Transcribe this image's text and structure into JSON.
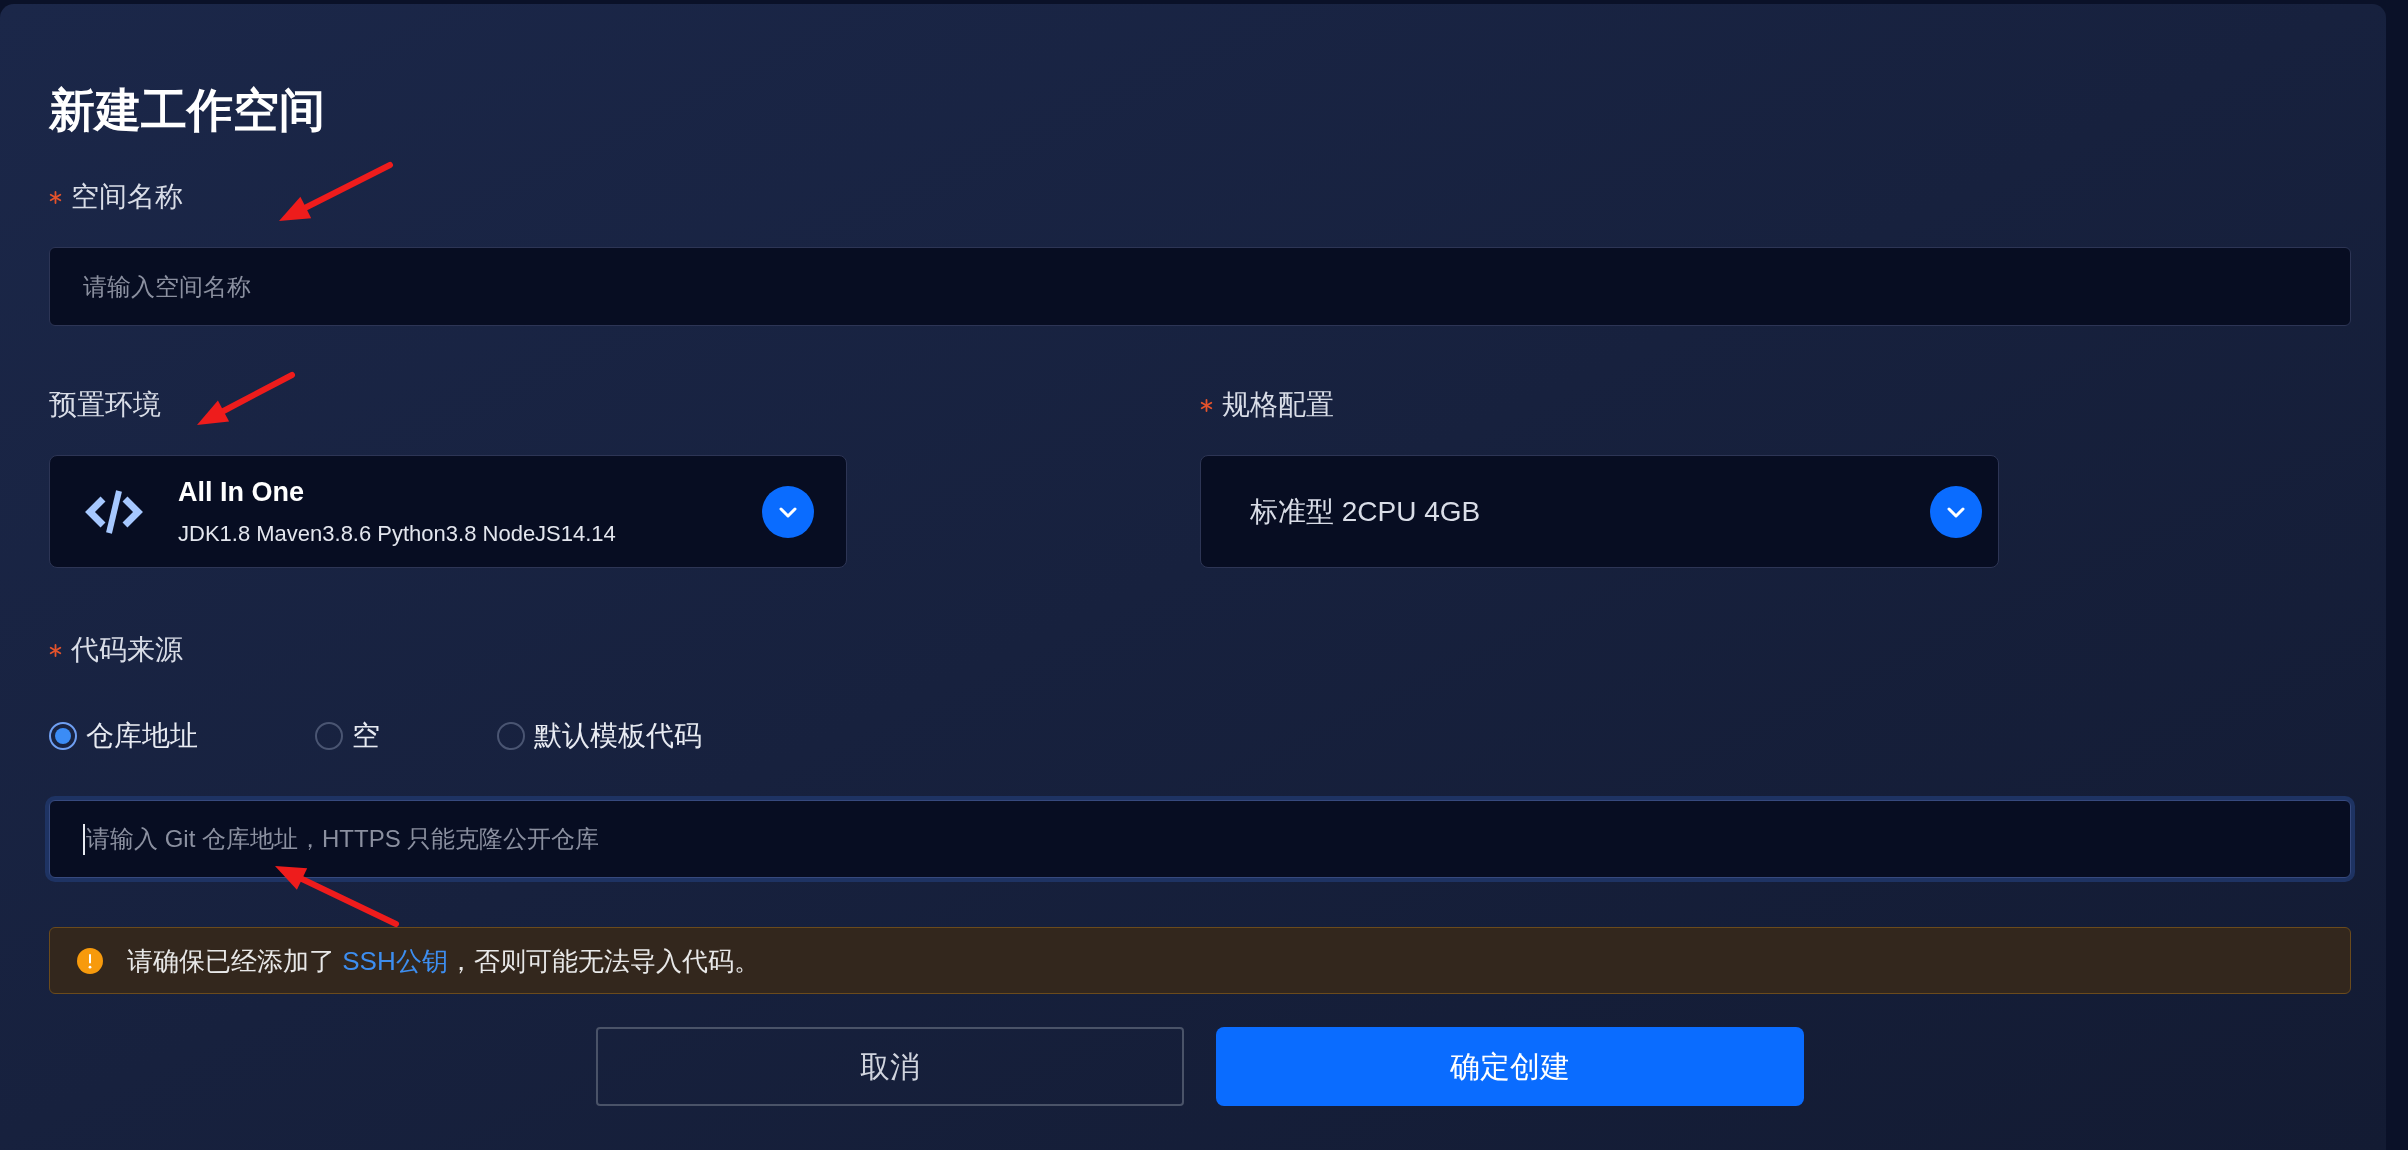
{
  "dialog": {
    "title": "新建工作空间"
  },
  "workspace_name": {
    "label": "空间名称",
    "required": true,
    "placeholder": "请输入空间名称"
  },
  "environment": {
    "label": "预置环境",
    "required": false,
    "name": "All In One",
    "description": "JDK1.8 Maven3.8.6 Python3.8 NodeJS14.14"
  },
  "spec": {
    "label": "规格配置",
    "required": true,
    "value": "标准型 2CPU 4GB"
  },
  "code_source": {
    "label": "代码来源",
    "required": true,
    "options": [
      {
        "label": "仓库地址",
        "selected": true
      },
      {
        "label": "空",
        "selected": false
      },
      {
        "label": "默认模板代码",
        "selected": false
      }
    ],
    "repository_field": {
      "placeholder": "请输入 Git 仓库地址，HTTPS 只能克隆公开仓库",
      "focused": true
    }
  },
  "notice": {
    "kind": "warning",
    "parts": [
      {
        "kind": "text",
        "text": "请确保已经添加了 "
      },
      {
        "kind": "link",
        "text": "SSH公钥"
      },
      {
        "kind": "text",
        "text": "，否则可能无法导入代码。"
      }
    ]
  },
  "buttons": [
    {
      "label": "取消",
      "kind": "secondary"
    },
    {
      "label": "确定创建",
      "kind": "primary"
    }
  ]
}
